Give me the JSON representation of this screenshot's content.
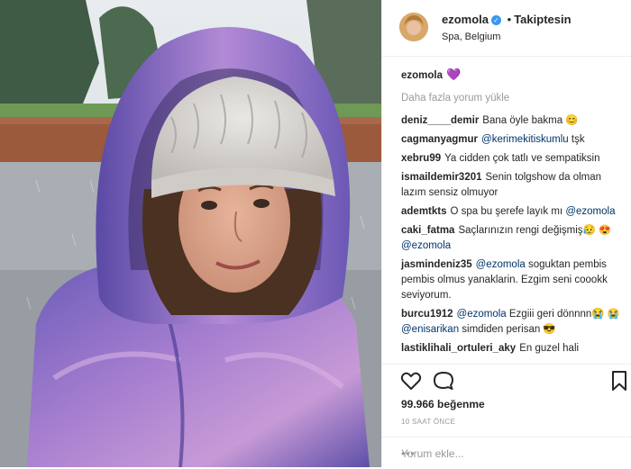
{
  "post": {
    "username": "ezomola",
    "verified_glyph": "✓",
    "separator": "•",
    "follow_label": "Takiptesin",
    "location": "Spa, Belgium",
    "caption_user": "ezomola",
    "caption_emoji": "💜",
    "load_more_label": "Daha fazla yorum yükle",
    "likes": "99.966 beğenme",
    "time_ago": "10 SAAT ÖNCE",
    "add_comment_placeholder": "Yorum ekle...",
    "menu_dots": "•••"
  },
  "comments": [
    {
      "user": "deniz____demir",
      "text": "Bana öyle bakma 😊"
    },
    {
      "user": "cagmanyagmur",
      "mention": "@kerimekitiskumlu",
      "text": "tşk"
    },
    {
      "user": "xebru99",
      "text": "Ya cidden çok tatlı ve sempatiksin"
    },
    {
      "user": "ismaildemir3201",
      "text": "Senin tolgshow da olman lazım sensiz olmuyor"
    },
    {
      "user": "ademtkts",
      "text": "O spa bu şerefe layık mı",
      "mention": "@ezomola"
    },
    {
      "user": "caki_fatma",
      "text": "Saçlarınızın rengi değişmiş😥",
      "mention_prefix": "😍",
      "mention": "@ezomola"
    },
    {
      "user": "jasmindeniz35",
      "mention": "@ezomola",
      "text": "soguktan pembis pembis olmus yanaklarin. Ezgim seni coookk seviyorum."
    },
    {
      "user": "burcu1912",
      "mention": "@ezomola",
      "text": "Ezgiii geri dönnnn😭",
      "mention2_prefix": "😭",
      "mention2": "@enisarikan",
      "text2": "simdiden perisan 😎"
    },
    {
      "user": "lastiklihali_ortuleri_aky",
      "text": "En guzel hali"
    }
  ],
  "icons": {
    "like": "heart-outline-icon",
    "comment": "comment-bubble-icon",
    "save": "bookmark-icon",
    "verified": "verified-badge-icon"
  },
  "colors": {
    "verified_blue": "#3897f0",
    "mention_blue": "#003569",
    "muted_gray": "#999999",
    "jacket_purple": "#8b6fc2"
  }
}
